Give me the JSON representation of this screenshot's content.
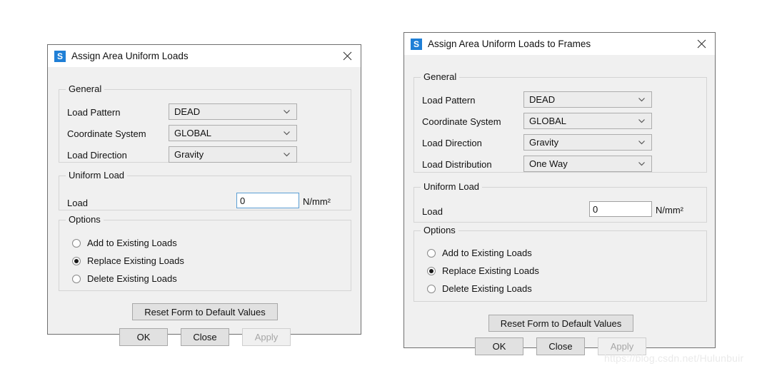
{
  "watermark": "https://blog.csdn.net/Hulunbuir",
  "icons": {
    "app": "S",
    "app_icon_name": "sap-logo-icon",
    "close": "close-icon",
    "chevron": "chevron-down-icon"
  },
  "colors": {
    "app_icon_blue": "#1f7fd6",
    "dialog_background": "#f0f0f0",
    "titlebar_background": "#ffffff",
    "dialog_border": "#6f6f6f",
    "group_border": "#d4d4d4",
    "combo_background": "#ececec",
    "combo_border": "#adadad",
    "focus_border": "#5b9ed4",
    "button_face": "#e1e1e1",
    "disabled_text": "#a6a6a6",
    "watermark": "#eaeaea"
  },
  "dialog_left": {
    "title": "Assign Area Uniform Loads",
    "groups": {
      "general": {
        "legend": "General",
        "fields": [
          {
            "label": "Load Pattern",
            "value": "DEAD"
          },
          {
            "label": "Coordinate System",
            "value": "GLOBAL"
          },
          {
            "label": "Load Direction",
            "value": "Gravity"
          }
        ]
      },
      "uniform_load": {
        "legend": "Uniform Load",
        "label": "Load",
        "value": "0",
        "unit": "N/mm²"
      },
      "options": {
        "legend": "Options",
        "items": [
          {
            "label": "Add to Existing Loads",
            "checked": false
          },
          {
            "label": "Replace Existing Loads",
            "checked": true
          },
          {
            "label": "Delete Existing Loads",
            "checked": false
          }
        ]
      }
    },
    "buttons": {
      "reset": "Reset Form to Default Values",
      "ok": "OK",
      "close": "Close",
      "apply": "Apply",
      "apply_enabled": false
    }
  },
  "dialog_right": {
    "title": "Assign Area Uniform Loads to Frames",
    "groups": {
      "general": {
        "legend": "General",
        "fields": [
          {
            "label": "Load Pattern",
            "value": "DEAD"
          },
          {
            "label": "Coordinate System",
            "value": "GLOBAL"
          },
          {
            "label": "Load Direction",
            "value": "Gravity"
          },
          {
            "label": "Load Distribution",
            "value": "One Way"
          }
        ]
      },
      "uniform_load": {
        "legend": "Uniform Load",
        "label": "Load",
        "value": "0",
        "unit": "N/mm²"
      },
      "options": {
        "legend": "Options",
        "items": [
          {
            "label": "Add to Existing Loads",
            "checked": false
          },
          {
            "label": "Replace Existing Loads",
            "checked": true
          },
          {
            "label": "Delete Existing Loads",
            "checked": false
          }
        ]
      }
    },
    "buttons": {
      "reset": "Reset Form to Default Values",
      "ok": "OK",
      "close": "Close",
      "apply": "Apply",
      "apply_enabled": false
    }
  }
}
